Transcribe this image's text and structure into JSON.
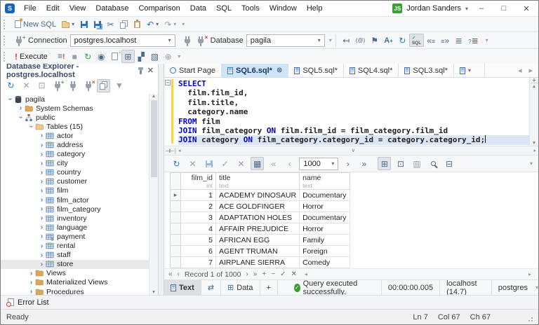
{
  "titlebar": {
    "app_initial": "S",
    "menus": [
      "File",
      "Edit",
      "View",
      "Database",
      "Comparison",
      "Data",
      "SQL",
      "Tools",
      "Window",
      "Help"
    ],
    "user_initials": "JS",
    "user_name": "Jordan Sanders"
  },
  "toolbar_main": {
    "new_sql_label": "New SQL"
  },
  "toolbar_connection": {
    "connection_label": "Connection",
    "connection_value": "postgres.localhost",
    "database_label": "Database",
    "database_value": "pagila"
  },
  "toolbar_execute": {
    "execute_label": "Execute",
    "format_button_text": "SQL"
  },
  "explorer": {
    "title": "Database Explorer - postgres.localhost",
    "tree": [
      {
        "depth": 0,
        "icon": "database",
        "label": "pagila",
        "state": "expanded"
      },
      {
        "depth": 1,
        "icon": "folder",
        "label": "System Schemas",
        "state": "collapsed"
      },
      {
        "depth": 1,
        "icon": "schema",
        "label": "public",
        "state": "expanded"
      },
      {
        "depth": 2,
        "icon": "folder-open",
        "label": "Tables (15)",
        "state": "expanded"
      },
      {
        "depth": 3,
        "icon": "table",
        "label": "actor",
        "state": "collapsed"
      },
      {
        "depth": 3,
        "icon": "table",
        "label": "address",
        "state": "collapsed"
      },
      {
        "depth": 3,
        "icon": "table",
        "label": "category",
        "state": "collapsed"
      },
      {
        "depth": 3,
        "icon": "table",
        "label": "city",
        "state": "collapsed"
      },
      {
        "depth": 3,
        "icon": "table",
        "label": "country",
        "state": "collapsed"
      },
      {
        "depth": 3,
        "icon": "table",
        "label": "customer",
        "state": "collapsed"
      },
      {
        "depth": 3,
        "icon": "table",
        "label": "film",
        "state": "collapsed"
      },
      {
        "depth": 3,
        "icon": "table",
        "label": "film_actor",
        "state": "collapsed"
      },
      {
        "depth": 3,
        "icon": "table",
        "label": "film_category",
        "state": "collapsed"
      },
      {
        "depth": 3,
        "icon": "table",
        "label": "inventory",
        "state": "collapsed"
      },
      {
        "depth": 3,
        "icon": "table",
        "label": "language",
        "state": "collapsed"
      },
      {
        "depth": 3,
        "icon": "table-part",
        "label": "payment",
        "state": "collapsed"
      },
      {
        "depth": 3,
        "icon": "table",
        "label": "rental",
        "state": "collapsed"
      },
      {
        "depth": 3,
        "icon": "table",
        "label": "staff",
        "state": "collapsed"
      },
      {
        "depth": 3,
        "icon": "table",
        "label": "store",
        "state": "collapsed",
        "selected": true
      },
      {
        "depth": 2,
        "icon": "folder",
        "label": "Views",
        "state": "collapsed"
      },
      {
        "depth": 2,
        "icon": "folder",
        "label": "Materialized Views",
        "state": "collapsed"
      },
      {
        "depth": 2,
        "icon": "folder",
        "label": "Procedures",
        "state": "collapsed"
      }
    ]
  },
  "document_tabs": [
    {
      "label": "Start Page",
      "icon": "start-page",
      "active": false,
      "closable": false
    },
    {
      "label": "SQL6.sql*",
      "icon": "sql-doc",
      "active": true,
      "closable": true
    },
    {
      "label": "SQL5.sql*",
      "icon": "sql-doc",
      "active": false,
      "closable": false
    },
    {
      "label": "SQL4.sql*",
      "icon": "sql-doc",
      "active": false,
      "closable": false
    },
    {
      "label": "SQL3.sql*",
      "icon": "sql-doc",
      "active": false,
      "closable": false
    }
  ],
  "editor": {
    "lines": [
      {
        "tokens": [
          {
            "t": "kw",
            "s": "SELECT"
          }
        ]
      },
      {
        "tokens": [
          {
            "t": "id",
            "s": "  film.film_id,"
          }
        ]
      },
      {
        "tokens": [
          {
            "t": "id",
            "s": "  film.title,"
          }
        ]
      },
      {
        "tokens": [
          {
            "t": "id",
            "s": "  category.name"
          }
        ]
      },
      {
        "tokens": [
          {
            "t": "kw",
            "s": "FROM"
          },
          {
            "t": "id",
            "s": " film"
          }
        ]
      },
      {
        "tokens": [
          {
            "t": "kw",
            "s": "JOIN"
          },
          {
            "t": "id",
            "s": " film_category "
          },
          {
            "t": "kw",
            "s": "ON"
          },
          {
            "t": "id",
            "s": " film.film_id = film_category.film_id"
          }
        ]
      },
      {
        "tokens": [
          {
            "t": "kw",
            "s": "JOIN"
          },
          {
            "t": "id",
            "s": " category "
          },
          {
            "t": "kw",
            "s": "ON"
          },
          {
            "t": "id",
            "s": " film_category.category_id = category.category_id;"
          }
        ],
        "current": true
      }
    ]
  },
  "results": {
    "page_size": "1000",
    "columns": [
      {
        "name": "film_id",
        "type": "int"
      },
      {
        "name": "title",
        "type": "text"
      },
      {
        "name": "name",
        "type": "text"
      }
    ],
    "rows": [
      [
        "1",
        "ACADEMY DINOSAUR",
        "Documentary"
      ],
      [
        "2",
        "ACE GOLDFINGER",
        "Horror"
      ],
      [
        "3",
        "ADAPTATION HOLES",
        "Documentary"
      ],
      [
        "4",
        "AFFAIR PREJUDICE",
        "Horror"
      ],
      [
        "5",
        "AFRICAN EGG",
        "Family"
      ],
      [
        "6",
        "AGENT TRUMAN",
        "Foreign"
      ],
      [
        "7",
        "AIRPLANE SIERRA",
        "Comedy"
      ]
    ],
    "record_status": "Record 1 of 1000"
  },
  "bottom_bar": {
    "text_tab": "Text",
    "data_tab": "Data",
    "add_tab": "+",
    "status_message": "Query executed successfully.",
    "execution_time": "00:00:00.005",
    "server": "localhost (14.7)",
    "database_user": "postgres"
  },
  "error_list": {
    "label": "Error List"
  },
  "status_bar": {
    "state": "Ready",
    "line": "Ln 7",
    "column": "Col 67",
    "character": "Ch 67"
  },
  "colors": {
    "accent_blue": "#1565c0",
    "badge_green": "#38a135",
    "active_tab_blue": "#cde4f9",
    "keyword_blue": "#0000d4",
    "change_bar_yellow": "#f5d63c",
    "success_green": "#33a02c",
    "execute_red": "#d83b2f"
  }
}
